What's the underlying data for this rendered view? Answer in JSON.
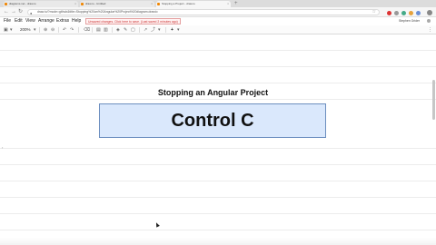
{
  "browser": {
    "tabs": [
      {
        "label": "diagrams.net - draw.io",
        "active": false
      },
      {
        "label": "draw.io - Untitled",
        "active": false
      },
      {
        "label": "Stopping a Project - draw.io",
        "active": true
      }
    ],
    "url": "draw.io/?mode=github&title=Stopping%20an%20Angular%20Project%20diagram.drawio",
    "user_initials": "Stephen"
  },
  "menu": {
    "items": [
      "File",
      "Edit",
      "View",
      "Arrange",
      "Extras",
      "Help"
    ],
    "unsaved_notice": "Unsaved changes. Click here to save. (Last saved 2 minutes ago)",
    "user_name": "Stephen Grider"
  },
  "toolbar": {
    "zoom": "200%"
  },
  "canvas": {
    "title": "Stopping an Angular Project",
    "box_label": "Control C",
    "box_fill": "#dae8fc",
    "box_stroke": "#6c8ebf"
  }
}
